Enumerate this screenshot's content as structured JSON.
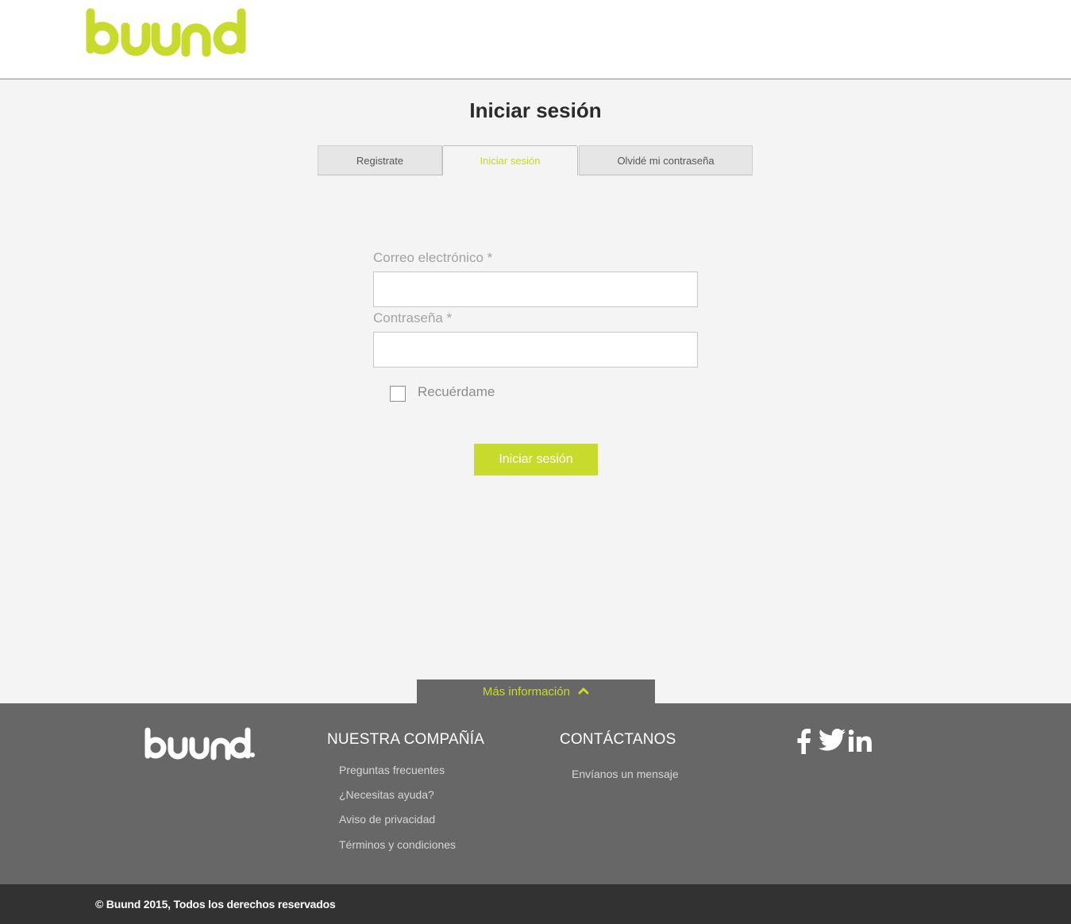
{
  "header": {
    "logo_text": "buund"
  },
  "page": {
    "title": "Iniciar sesión"
  },
  "tabs": [
    {
      "label": "Registrate",
      "active": false
    },
    {
      "label": "Iniciar sesión",
      "active": true
    },
    {
      "label": "Olvidé mi contraseña",
      "active": false
    }
  ],
  "form": {
    "email_label": "Correo electrónico *",
    "email_value": "",
    "password_label": "Contraseña *",
    "password_value": "",
    "remember_label": "Recuérdame",
    "remember_checked": false,
    "submit_label": "Iniciar sesión"
  },
  "more_info": {
    "label": "Más información",
    "icon": "chevron-up-icon"
  },
  "footer": {
    "logo_text": "buund.",
    "company": {
      "title": "NUESTRA COMPAÑÍA",
      "links": [
        "Preguntas frecuentes",
        "¿Necesitas ayuda?",
        "Aviso de privacidad",
        "Términos y condiciones"
      ]
    },
    "contact": {
      "title": "CONTÁCTANOS",
      "links": [
        "Envíanos un mensaje"
      ]
    },
    "social": [
      "facebook-icon",
      "twitter-icon",
      "linkedin-icon"
    ],
    "copyright": "© Buund 2015, Todos los derechos reservados"
  },
  "colors": {
    "accent": "#c8da2b",
    "footer_bg": "#676767",
    "bottom_bar": "#323232",
    "page_bg": "#f4f4f4"
  }
}
